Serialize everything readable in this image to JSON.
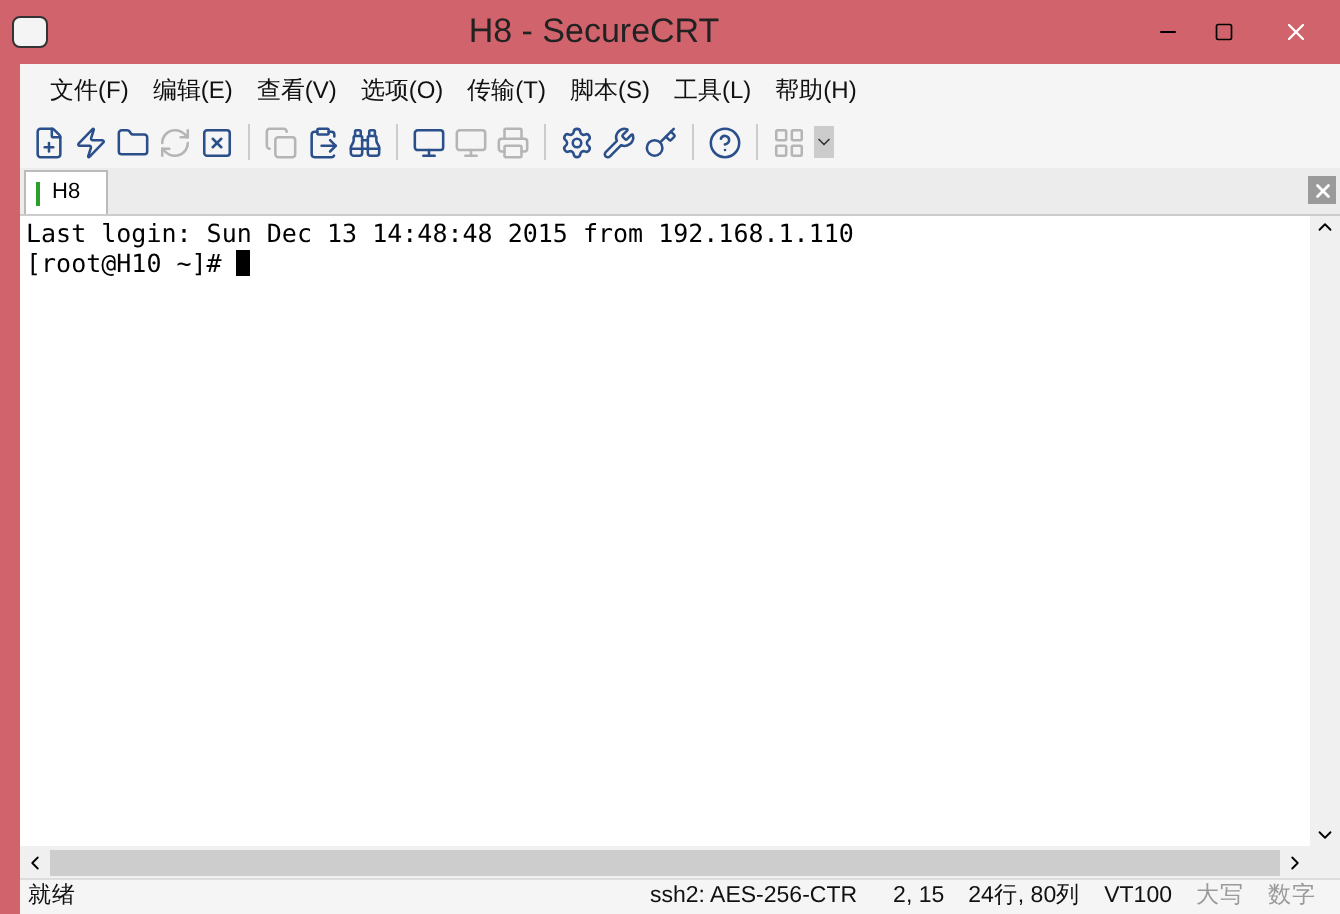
{
  "window": {
    "title": "H8 - SecureCRT"
  },
  "menu": [
    "文件(F)",
    "编辑(E)",
    "查看(V)",
    "选项(O)",
    "传输(T)",
    "脚本(S)",
    "工具(L)",
    "帮助(H)"
  ],
  "toolbar": [
    {
      "kind": "connect",
      "disabled": false
    },
    {
      "kind": "quick-connect",
      "disabled": false
    },
    {
      "kind": "folder",
      "disabled": false
    },
    {
      "kind": "reconnect",
      "disabled": true
    },
    {
      "kind": "disconnect",
      "disabled": false
    },
    {
      "kind": "separator"
    },
    {
      "kind": "copy",
      "disabled": true
    },
    {
      "kind": "paste",
      "disabled": false
    },
    {
      "kind": "find",
      "disabled": false
    },
    {
      "kind": "separator"
    },
    {
      "kind": "print",
      "disabled": false
    },
    {
      "kind": "print-selection",
      "disabled": true
    },
    {
      "kind": "printer",
      "disabled": true
    },
    {
      "kind": "separator"
    },
    {
      "kind": "options",
      "disabled": false
    },
    {
      "kind": "global-options",
      "disabled": false
    },
    {
      "kind": "key",
      "disabled": false
    },
    {
      "kind": "separator"
    },
    {
      "kind": "help",
      "disabled": false
    },
    {
      "kind": "separator"
    },
    {
      "kind": "map",
      "disabled": true
    }
  ],
  "tabs": [
    {
      "label": "H8",
      "selected": true
    }
  ],
  "terminal": {
    "lines": [
      "Last login: Sun Dec 13 14:48:48 2015 from 192.168.1.110",
      "[root@H10 ~]# "
    ]
  },
  "status_bar": [
    {
      "text": "就绪",
      "disabled": false
    },
    {
      "text": "ssh2: AES-256-CTR",
      "disabled": false
    },
    {
      "text": "2, 15",
      "disabled": false
    },
    {
      "text": "24行, 80列",
      "disabled": false
    },
    {
      "text": "VT100",
      "disabled": false
    },
    {
      "text": "大写",
      "disabled": true
    },
    {
      "text": "数字",
      "disabled": true
    }
  ]
}
